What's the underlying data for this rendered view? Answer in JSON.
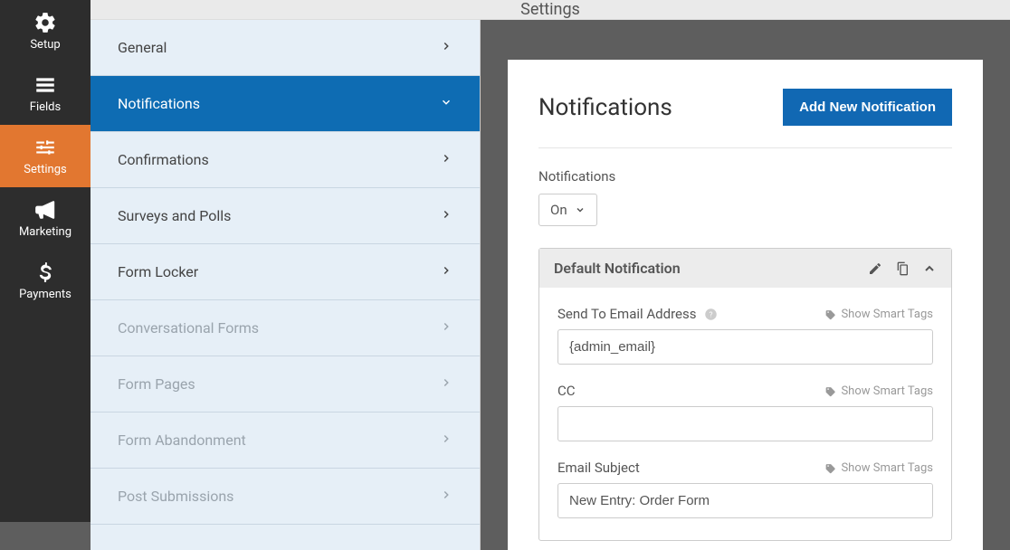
{
  "sidebar": {
    "items": [
      {
        "label": "Setup"
      },
      {
        "label": "Fields"
      },
      {
        "label": "Settings"
      },
      {
        "label": "Marketing"
      },
      {
        "label": "Payments"
      }
    ]
  },
  "header": {
    "title": "Settings"
  },
  "settings_list": {
    "items": [
      {
        "label": "General"
      },
      {
        "label": "Notifications"
      },
      {
        "label": "Confirmations"
      },
      {
        "label": "Surveys and Polls"
      },
      {
        "label": "Form Locker"
      },
      {
        "label": "Conversational Forms"
      },
      {
        "label": "Form Pages"
      },
      {
        "label": "Form Abandonment"
      },
      {
        "label": "Post Submissions"
      }
    ]
  },
  "panel": {
    "title": "Notifications",
    "add_button": "Add New Notification",
    "list_label": "Notifications",
    "toggle_value": "On",
    "box_title": "Default Notification",
    "smart_tags_label": "Show Smart Tags",
    "fields": {
      "send_to": {
        "label": "Send To Email Address",
        "value": "{admin_email}"
      },
      "cc": {
        "label": "CC",
        "value": ""
      },
      "subject": {
        "label": "Email Subject",
        "value": "New Entry: Order Form"
      }
    }
  }
}
